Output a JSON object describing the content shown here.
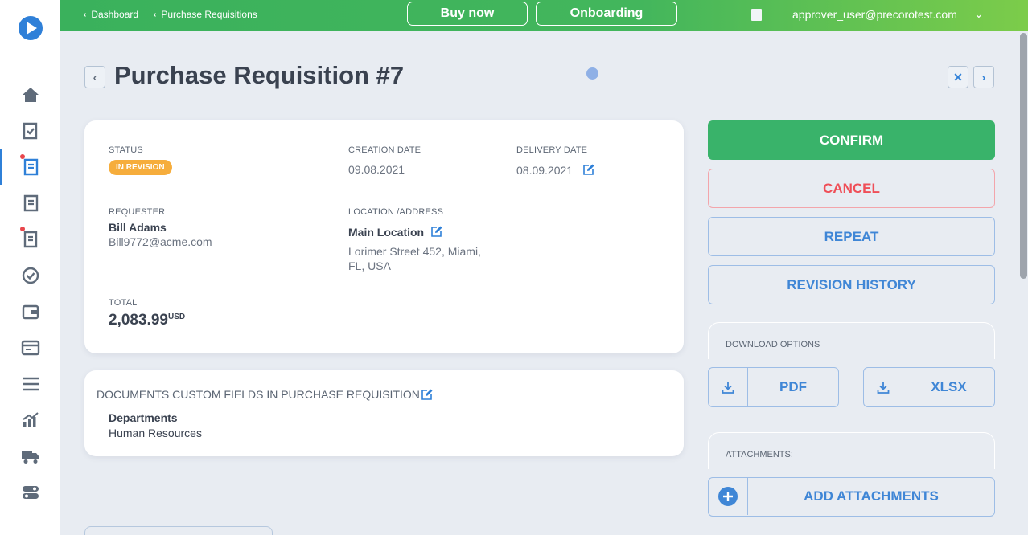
{
  "topbar": {
    "breadcrumbs": [
      "Dashboard",
      "Purchase Requisitions"
    ],
    "buy_now": "Buy now",
    "onboarding": "Onboarding",
    "user_email": "approver_user@precorotest.com"
  },
  "header": {
    "title": "Purchase Requisition #7"
  },
  "details": {
    "status_label": "STATUS",
    "status_value": "IN REVISION",
    "creation_label": "CREATION DATE",
    "creation_value": "09.08.2021",
    "delivery_label": "DELIVERY DATE",
    "delivery_value": "08.09.2021",
    "requester_label": "REQUESTER",
    "requester_name": "Bill Adams",
    "requester_email": "Bill9772@acme.com",
    "location_label": "LOCATION /ADDRESS",
    "location_name": "Main Location",
    "address_line1": "Lorimer Street 452, Miami,",
    "address_line2": "FL, USA",
    "total_label": "TOTAL",
    "total_value": "2,083.99",
    "total_currency": "USD"
  },
  "custom_fields": {
    "title": "DOCUMENTS CUSTOM FIELDS IN PURCHASE REQUISITION",
    "field_label": "Departments",
    "field_value": "Human Resources"
  },
  "actions": {
    "confirm": "CONFIRM",
    "cancel": "CANCEL",
    "repeat": "REPEAT",
    "revision_history": "REVISION HISTORY",
    "download_options_label": "DOWNLOAD OPTIONS",
    "pdf": "PDF",
    "xlsx": "XLSX",
    "attachments_label": "ATTACHMENTS:",
    "add_attachments": "ADD ATTACHMENTS"
  },
  "colors": {
    "accent": "#2f80d8",
    "confirm": "#39b36a",
    "cancel": "#ef4f58",
    "status_badge": "#f6ad3c"
  }
}
